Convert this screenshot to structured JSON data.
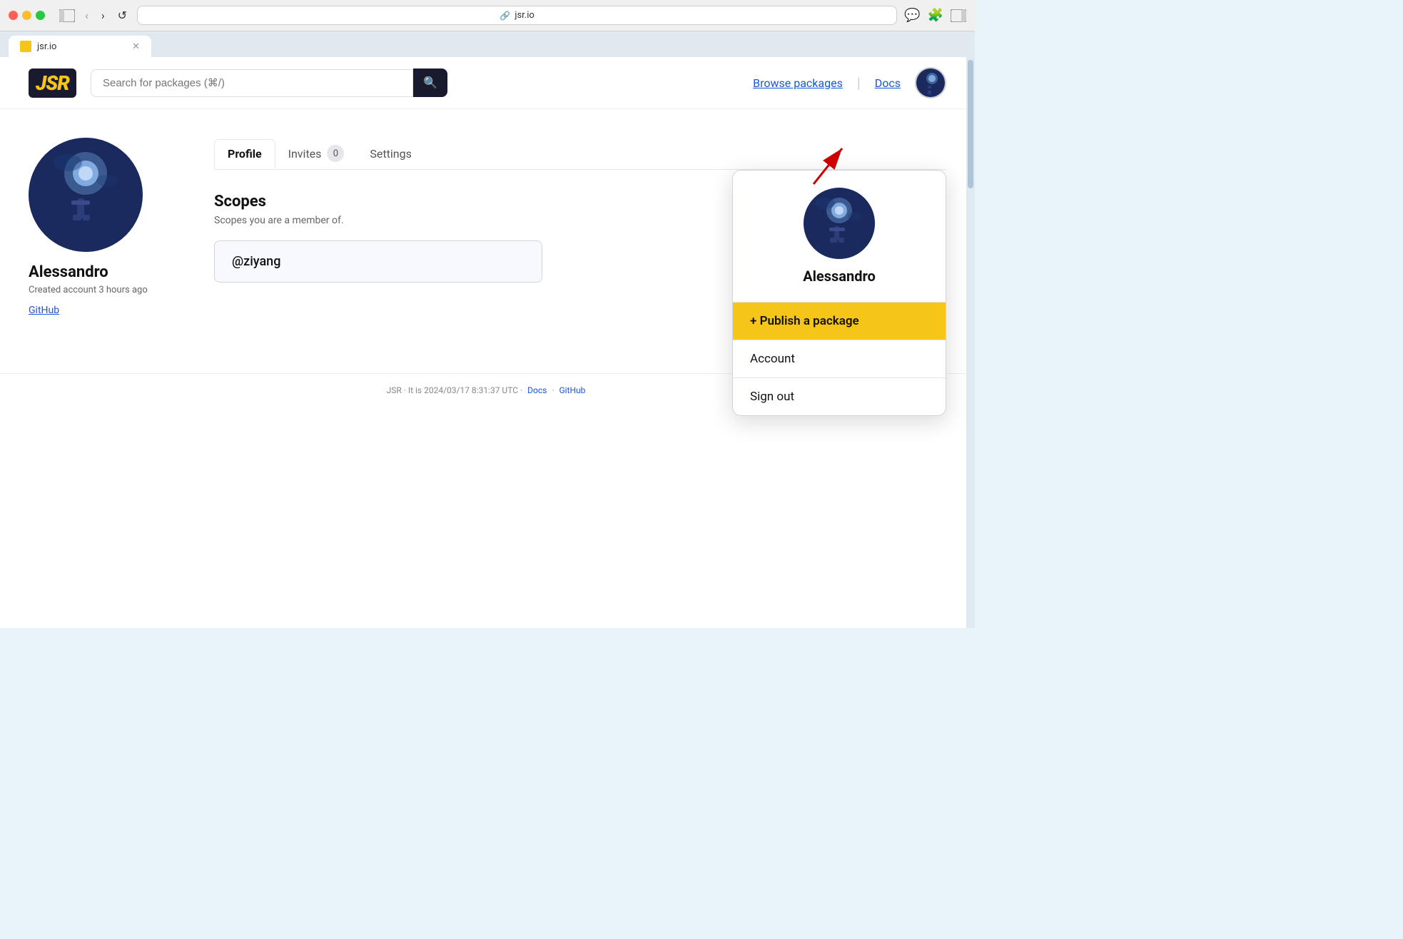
{
  "browser": {
    "url": "jsr.io",
    "tab_title": "jsr.io"
  },
  "header": {
    "logo": "JSR",
    "search_placeholder": "Search for packages (⌘/)",
    "browse_packages": "Browse packages",
    "docs": "Docs"
  },
  "profile": {
    "name": "Alessandro",
    "meta": "Created account 3 hours ago",
    "github_label": "GitHub"
  },
  "tabs": [
    {
      "label": "Profile",
      "active": true
    },
    {
      "label": "Invites",
      "badge": "0"
    },
    {
      "label": "Settings"
    }
  ],
  "scopes": {
    "title": "Scopes",
    "subtitle": "Scopes you are a member of.",
    "items": [
      "@ziyang"
    ]
  },
  "dropdown": {
    "username": "Alessandro",
    "publish_label": "+ Publish a package",
    "account_label": "Account",
    "signout_label": "Sign out"
  },
  "footer": {
    "text": "JSR · It is 2024/03/17 8:31:37 UTC ·",
    "docs_link": "Docs",
    "github_link": "GitHub"
  }
}
